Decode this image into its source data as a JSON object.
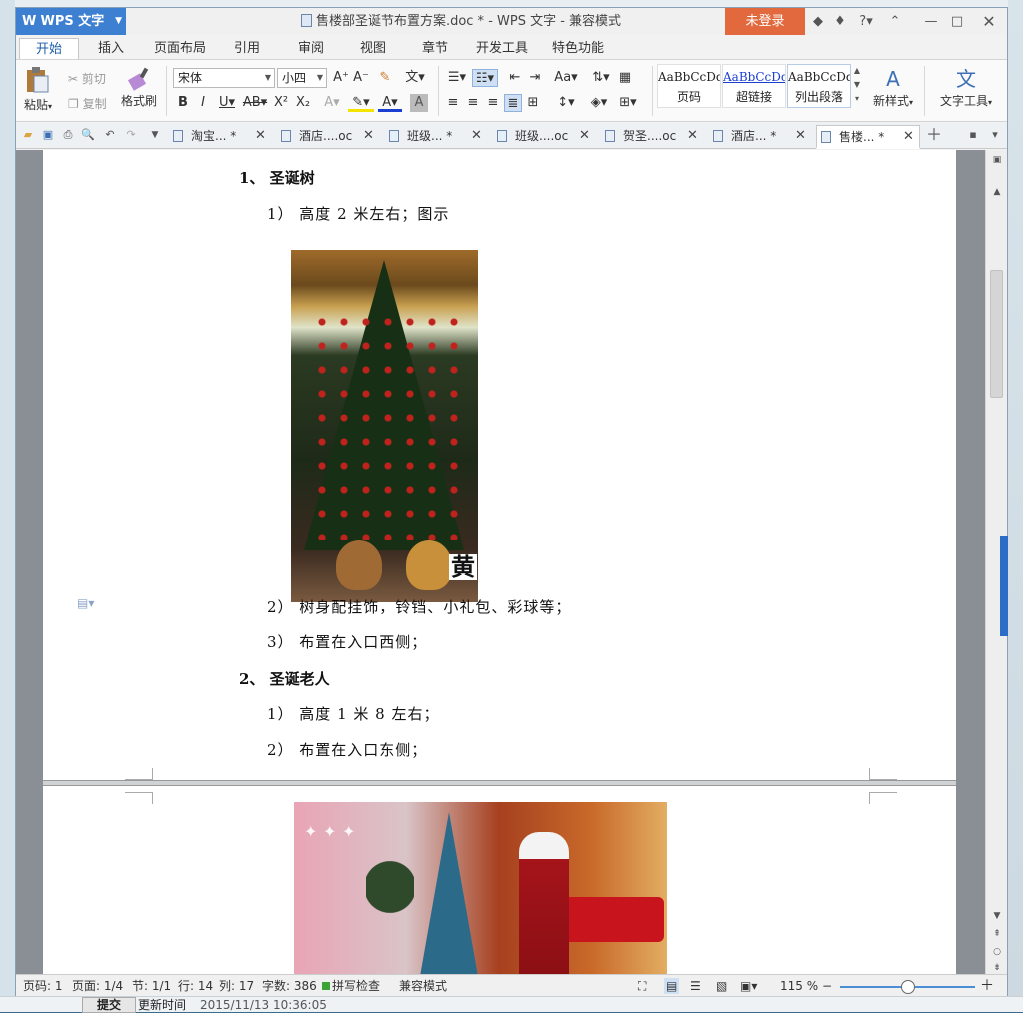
{
  "window": {
    "app_name": "WPS 文字",
    "app_letter": "W",
    "title": "售楼部圣诞节布置方案.doc * - WPS 文字 - 兼容模式",
    "login": "未登录",
    "help": "?"
  },
  "tabs": [
    "开始",
    "插入",
    "页面布局",
    "引用",
    "审阅",
    "视图",
    "章节",
    "开发工具",
    "特色功能"
  ],
  "ribbon": {
    "paste": "粘贴",
    "cut": "剪切",
    "copy": "复制",
    "format_painter": "格式刷",
    "font_name": "宋体",
    "font_size": "小四",
    "styles": [
      {
        "sample": "AaBbCcDd",
        "name": "页码"
      },
      {
        "sample": "AaBbCcDd",
        "name": "超链接"
      },
      {
        "sample": "AaBbCcDd",
        "name": "列出段落"
      }
    ],
    "new_style": "新样式",
    "text_tools": "文字工具"
  },
  "doc_tabs": [
    {
      "label": "淘宝... *"
    },
    {
      "label": "酒店....oc"
    },
    {
      "label": "班级... *"
    },
    {
      "label": "班级....oc"
    },
    {
      "label": "贺圣....oc"
    },
    {
      "label": "酒店... *"
    },
    {
      "label": "售楼... *"
    }
  ],
  "document": {
    "h1": "1、  圣诞树",
    "p1": "1）   高度 2 米左右；图示",
    "tree_watermark": "黄",
    "p2": "2）   树身配挂饰，铃铛、小礼包、彩球等；",
    "p3": "3）   布置在入口西侧；",
    "h2": "2、  圣诞老人",
    "p4": "1）   高度 1 米 8 左右；",
    "p5": "2）   布置在入口东侧；"
  },
  "status": {
    "page": "页码: 1",
    "pages": "页面: 1/4",
    "section": "节: 1/1",
    "row": "行: 14",
    "col": "列: 17",
    "words": "字数: 386",
    "spell": "拼写检查",
    "compat": "兼容模式",
    "zoom": "115 %"
  },
  "background": {
    "submit": "提交",
    "update_label": "更新时间",
    "update_time": "2015/11/13 10:36:05"
  }
}
